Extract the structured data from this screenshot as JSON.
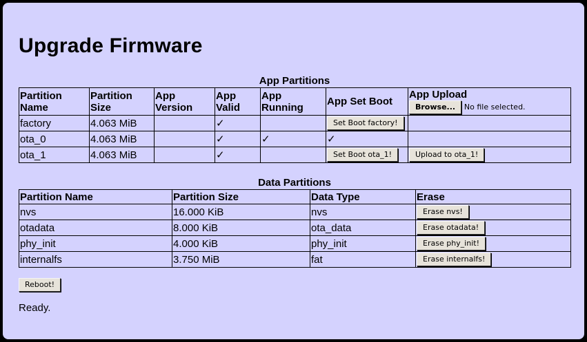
{
  "page": {
    "title": "Upgrade Firmware",
    "status": "Ready.",
    "reboot_label": "Reboot!"
  },
  "app_partitions": {
    "caption": "App Partitions",
    "headers": {
      "name": "Partition Name",
      "size": "Partition Size",
      "version": "App Version",
      "valid": "App Valid",
      "running": "App Running",
      "set_boot": "App Set Boot",
      "upload": "App Upload"
    },
    "browse_label": "Browse...",
    "no_file_text": "No file selected.",
    "check_glyph": "✓",
    "rows": [
      {
        "name": "factory",
        "size": "4.063 MiB",
        "version": "",
        "valid": "✓",
        "running": "",
        "set_boot_button": "Set Boot factory!",
        "set_boot_text": "",
        "upload_button": ""
      },
      {
        "name": "ota_0",
        "size": "4.063 MiB",
        "version": "",
        "valid": "✓",
        "running": "✓",
        "set_boot_button": "",
        "set_boot_text": "✓",
        "upload_button": ""
      },
      {
        "name": "ota_1",
        "size": "4.063 MiB",
        "version": "",
        "valid": "✓",
        "running": "",
        "set_boot_button": "Set Boot ota_1!",
        "set_boot_text": "",
        "upload_button": "Upload to ota_1!"
      }
    ]
  },
  "data_partitions": {
    "caption": "Data Partitions",
    "headers": {
      "name": "Partition Name",
      "size": "Partition Size",
      "type": "Data Type",
      "erase": "Erase"
    },
    "rows": [
      {
        "name": "nvs",
        "size": "16.000 KiB",
        "type": "nvs",
        "erase_button": "Erase nvs!"
      },
      {
        "name": "otadata",
        "size": "8.000 KiB",
        "type": "ota_data",
        "erase_button": "Erase otadata!"
      },
      {
        "name": "phy_init",
        "size": "4.000 KiB",
        "type": "phy_init",
        "erase_button": "Erase phy_init!"
      },
      {
        "name": "internalfs",
        "size": "3.750 MiB",
        "type": "fat",
        "erase_button": "Erase internalfs!"
      }
    ]
  },
  "colors": {
    "panel_background": "#d4d2fe",
    "frame": "#000000",
    "button_face": "#e7e3da"
  }
}
